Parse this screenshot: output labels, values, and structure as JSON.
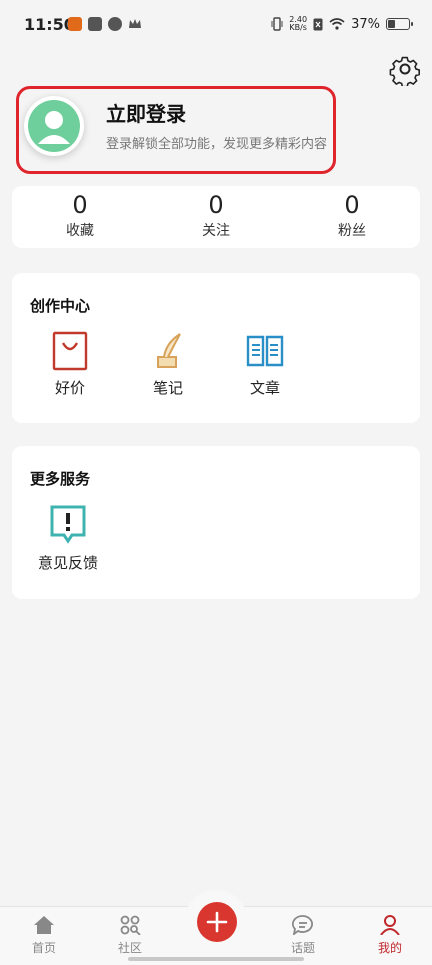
{
  "status_bar": {
    "time": "11:50",
    "net_speed_value": "2.40",
    "net_speed_unit": "KB/s",
    "battery": "37%",
    "battery_level": 0.37
  },
  "login": {
    "title": "立即登录",
    "subtitle": "登录解锁全部功能，发现更多精彩内容"
  },
  "stats": [
    {
      "value": "0",
      "label": "收藏"
    },
    {
      "value": "0",
      "label": "关注"
    },
    {
      "value": "0",
      "label": "粉丝"
    }
  ],
  "creation_center": {
    "title": "创作中心",
    "items": [
      {
        "label": "好价",
        "icon": "shopping-bag-icon"
      },
      {
        "label": "笔记",
        "icon": "quill-ink-icon"
      },
      {
        "label": "文章",
        "icon": "open-book-icon"
      }
    ]
  },
  "more_services": {
    "title": "更多服务",
    "items": [
      {
        "label": "意见反馈",
        "icon": "feedback-icon"
      }
    ]
  },
  "tabbar": {
    "items": [
      {
        "label": "首页",
        "icon": "home-icon"
      },
      {
        "label": "社区",
        "icon": "community-icon"
      },
      {
        "label": "话题",
        "icon": "chat-bubble-icon"
      },
      {
        "label": "我的",
        "icon": "person-icon",
        "active": true
      }
    ],
    "center_button_icon": "plus-icon"
  },
  "colors": {
    "accent": "#d9362f",
    "highlight_border": "#e0242b",
    "avatar_bg": "#6fcf9c",
    "active_tab": "#c0282c"
  }
}
